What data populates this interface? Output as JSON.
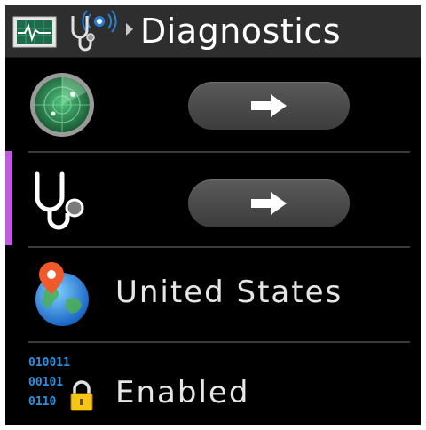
{
  "header": {
    "title": "Diagnostics",
    "icons": [
      "monitor-icon",
      "stethoscope-wireless-icon",
      "breadcrumb-arrow-icon"
    ]
  },
  "rows": [
    {
      "icon": "radar-icon",
      "button_icon": "arrow-right-icon"
    },
    {
      "icon": "stethoscope-icon",
      "button_icon": "arrow-right-icon",
      "selected": true
    },
    {
      "icon": "globe-location-icon",
      "label": "United States"
    },
    {
      "icon": "binary-lock-icon",
      "label": "Enabled",
      "binary_lines": [
        "010011",
        "00101",
        "0110"
      ]
    }
  ],
  "colors": {
    "header_bg": "#2e2e2e",
    "selection_accent": "#c05adf",
    "text": "#e6e6e6",
    "button": "#4a4a4a"
  }
}
